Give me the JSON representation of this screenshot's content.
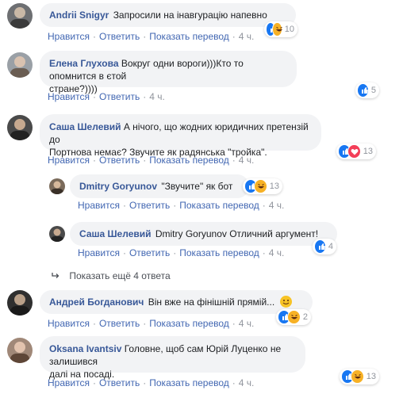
{
  "actions": {
    "like": "Нравится",
    "reply": "Ответить",
    "translate": "Показать перевод",
    "sep": "·"
  },
  "comments": [
    {
      "author": "Andrii Snigyr",
      "text": "Запросили на інавгурацію напевно",
      "time": "4 ч.",
      "reactions": [
        "like",
        "haha"
      ],
      "count": "10"
    },
    {
      "author": "Елена Глухова",
      "text_line1": "Вокруг одни вороги)))Кто то опомнится в єтой",
      "text_line2": "стране?))))",
      "time": "4 ч.",
      "reactions": [
        "like"
      ],
      "count": "5"
    },
    {
      "author": "Саша Шелевий",
      "text_line1": "А нічого, що жодних юридичних претензій до",
      "text_line2": "Портнова немає? Звучите як радянська \"тройка\".",
      "time": "4 ч.",
      "reactions": [
        "like",
        "love"
      ],
      "count": "13"
    },
    {
      "author": "Andrii Snigyr",
      "text": "Запросили на інавгурацію напевно",
      "time": "4 ч."
    }
  ],
  "replies": [
    {
      "author": "Dmitry Goryunov",
      "text": "\"Звучите\" як бот",
      "time": "4 ч.",
      "reactions": [
        "like",
        "haha"
      ],
      "count": "13"
    },
    {
      "author": "Саша Шелевий",
      "mention": "Dmitry Goryunov",
      "text": "Отличний аргумент!",
      "time": "4 ч.",
      "reactions": [
        "like"
      ],
      "count": "4"
    }
  ],
  "more_replies": "Показать ещё 4 ответа",
  "later_comments": [
    {
      "author": "Андрей Богданович",
      "text": "Він вже на фінішній прямій...",
      "time": "4 ч.",
      "reactions": [
        "like",
        "haha"
      ],
      "count": "2"
    },
    {
      "author": "Oksana Ivantsiv",
      "text_line1": "Головне, щоб сам Юрій Луценко не залишився",
      "text_line2": "далі на посаді.",
      "time": "4 ч.",
      "reactions": [
        "like",
        "haha"
      ],
      "count": "13"
    }
  ],
  "icons": {
    "reply_arrow": "reply-arrow-icon",
    "like": "like-reaction-icon",
    "haha": "haha-reaction-icon",
    "love": "love-reaction-icon"
  },
  "colors": {
    "link": "#385898",
    "action": "#4267b2",
    "meta": "#90949c",
    "bubble": "#f2f3f5",
    "like": "#1877f2",
    "haha": "#f7b125",
    "love": "#f33e58"
  }
}
